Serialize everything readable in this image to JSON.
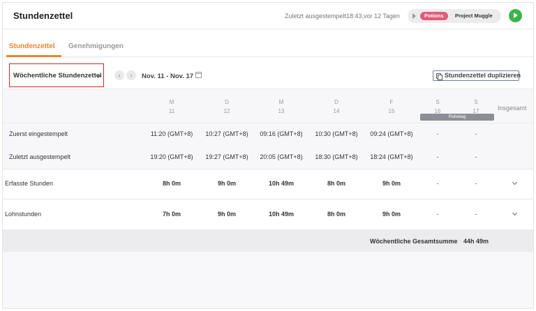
{
  "header": {
    "title": "Stundenzettel",
    "last_status": "Zuletzt ausgestempelt18:43,vor 12 Tagen",
    "tag": "Potions",
    "project": "Project Muggle"
  },
  "tabs": [
    {
      "label": "Stundenzettel",
      "active": true
    },
    {
      "label": "Genehmigungen",
      "active": false
    }
  ],
  "toolbar": {
    "view_selector": "Wöchentliche Stundenzettel",
    "date_range": "Nov. 11 - Nov. 17",
    "duplicate_label": "Stundenzettel duplizieren"
  },
  "days": [
    {
      "letter": "M",
      "num": "11"
    },
    {
      "letter": "D",
      "num": "12"
    },
    {
      "letter": "M",
      "num": "13"
    },
    {
      "letter": "D",
      "num": "14"
    },
    {
      "letter": "F",
      "num": "15"
    },
    {
      "letter": "S",
      "num": "16"
    },
    {
      "letter": "S",
      "num": "17"
    }
  ],
  "rest_day_label": "Ruhetag",
  "total_header": "Insgesamt",
  "rows": {
    "clock_in": {
      "label": "Zuerst eingestempelt",
      "values": [
        "11:20 (GMT+8)",
        "10:27 (GMT+8)",
        "09:16 (GMT+8)",
        "10:30 (GMT+8)",
        "09:24 (GMT+8)",
        "-",
        "-"
      ]
    },
    "clock_out": {
      "label": "Zuletzt ausgestempelt",
      "values": [
        "19:20 (GMT+8)",
        "19:27 (GMT+8)",
        "20:05 (GMT+8)",
        "18:30 (GMT+8)",
        "18:24 (GMT+8)",
        "-",
        "-"
      ]
    },
    "tracked": {
      "label": "Erfasste Stunden",
      "values": [
        "8h 0m",
        "9h 0m",
        "10h 49m",
        "8h 0m",
        "9h 0m",
        "-",
        "-"
      ]
    },
    "payroll": {
      "label": "Lohnstunden",
      "values": [
        "7h 0m",
        "9h 0m",
        "10h 49m",
        "8h 0m",
        "9h 0m",
        "-",
        "-"
      ]
    }
  },
  "summary": {
    "label": "Wöchentliche Gesamtsumme",
    "value": "44h 49m"
  },
  "colors": {
    "accent": "#e8842f",
    "tag": "#e05b7a",
    "start": "#3bb44a",
    "highlight_border": "#e02020"
  }
}
